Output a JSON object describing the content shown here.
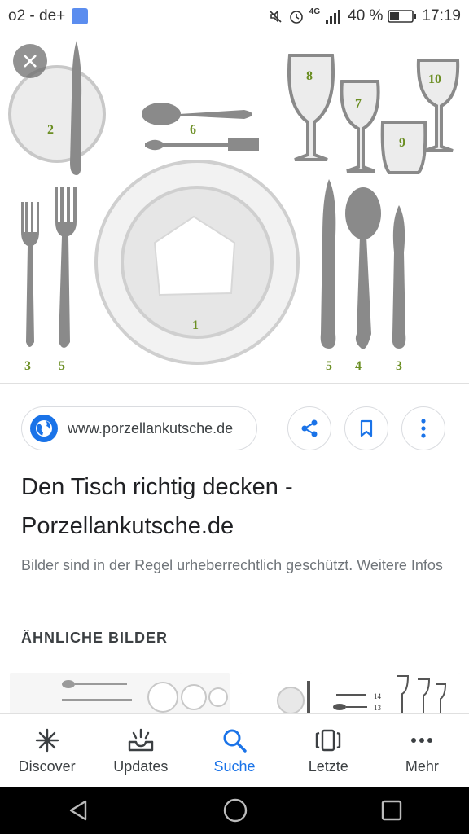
{
  "status_bar": {
    "carrier": "o2 - de+",
    "network": "4G",
    "battery": "40 %",
    "time": "17:19"
  },
  "hero": {
    "numbers": [
      "2",
      "6",
      "8",
      "7",
      "9",
      "10",
      "1",
      "3",
      "5",
      "5",
      "4",
      "3"
    ],
    "colors": {
      "utensil": "#8a8a8a",
      "plate_fill": "#ececec",
      "plate_stroke": "#d0d0d0",
      "number": "#6b8e23"
    }
  },
  "source": {
    "domain": "www.porzellankutsche.de"
  },
  "result": {
    "title": "Den Tisch richtig decken - Porzellankutsche.de",
    "subtitle": "Bilder sind in der Regel urheberrechtlich geschützt. Weitere Infos"
  },
  "similar": {
    "label": "ÄHNLICHE BILDER",
    "thumb2_numbers": [
      "14",
      "13"
    ]
  },
  "bottom_nav": {
    "items": [
      {
        "label": "Discover",
        "icon": "asterisk-icon"
      },
      {
        "label": "Updates",
        "icon": "updates-tray-icon"
      },
      {
        "label": "Suche",
        "icon": "search-icon",
        "active": true
      },
      {
        "label": "Letzte",
        "icon": "recent-cards-icon"
      },
      {
        "label": "Mehr",
        "icon": "more-dots-icon"
      }
    ]
  },
  "accent_color": "#1a73e8"
}
